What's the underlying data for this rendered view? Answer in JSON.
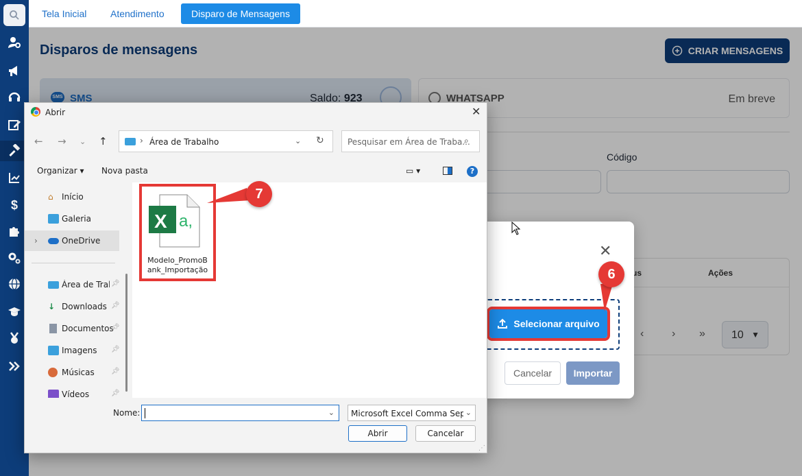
{
  "nav": {
    "tabs": [
      "Tela Inicial",
      "Atendimento",
      "Disparo de Mensagens"
    ]
  },
  "page": {
    "title": "Disparos de mensagens",
    "create_button": "CRIAR MENSAGENS"
  },
  "sms_card": {
    "label": "SMS",
    "badge": "SMS",
    "balance_label": "Saldo:",
    "balance_value": "923"
  },
  "whatsapp_card": {
    "label": "WHATSAPP",
    "status": "Em breve"
  },
  "filters": {
    "codigo_label": "Código"
  },
  "table": {
    "columns": [
      "us",
      "Ações"
    ],
    "per_page": "10"
  },
  "import_modal": {
    "select_button": "Selecionar arquivo",
    "cancel_button": "Cancelar",
    "import_button": "Importar"
  },
  "callouts": {
    "step_6": "6",
    "step_7": "7"
  },
  "file_dialog": {
    "title": "Abrir",
    "address": "Área de Trabalho",
    "search_placeholder": "Pesquisar em Área de Traba...",
    "organize": "Organizar",
    "new_folder": "Nova pasta",
    "nav_items": [
      {
        "label": "Início"
      },
      {
        "label": "Galeria"
      },
      {
        "label": "OneDrive"
      },
      {
        "label": "Área de Trabalho"
      },
      {
        "label": "Downloads"
      },
      {
        "label": "Documentos"
      },
      {
        "label": "Imagens"
      },
      {
        "label": "Músicas"
      },
      {
        "label": "Vídeos"
      }
    ],
    "file_name": "Modelo_PromoBank_Importação",
    "file_name_lines": [
      "Modelo_PromoB",
      "ank_Importação"
    ],
    "name_label": "Nome:",
    "name_value": "",
    "file_type": "Microsoft Excel Comma Separa",
    "open_button": "Abrir",
    "cancel_button": "Cancelar"
  },
  "colors": {
    "sidebar": "#0d3d7a",
    "accent": "#1d8be6",
    "callout": "#e53935",
    "excel_green": "#1d7a45"
  }
}
